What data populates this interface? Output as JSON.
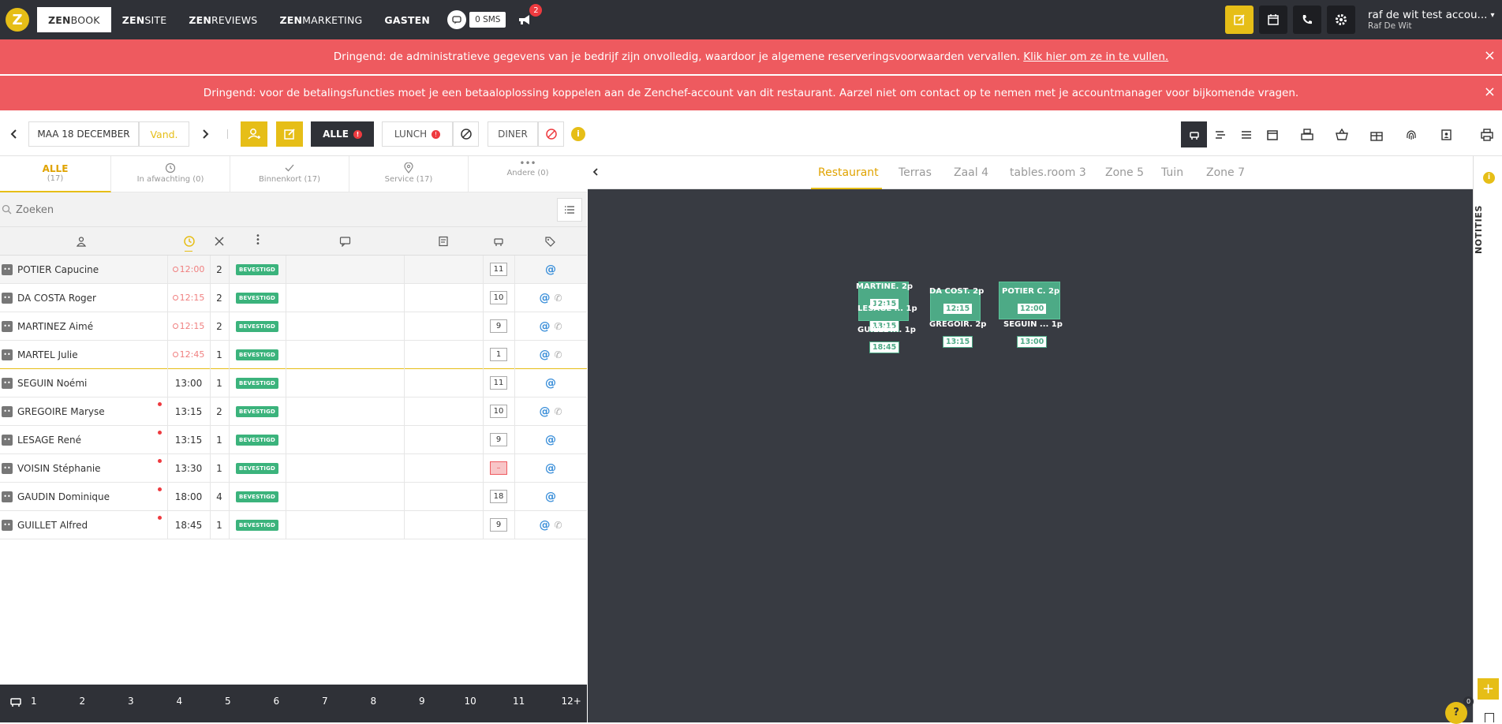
{
  "topnav": {
    "items": [
      {
        "bold": "ZEN",
        "light": "BOOK"
      },
      {
        "bold": "ZEN",
        "light": "SITE"
      },
      {
        "bold": "ZEN",
        "light": "REVIEWS"
      },
      {
        "bold": "ZEN",
        "light": "MARKETING"
      },
      {
        "bold": "GASTEN",
        "light": ""
      }
    ],
    "sms_label": "0 SMS",
    "notif_count": "2",
    "account_name": "raf de wit test accou...",
    "account_user": "Raf De Wit"
  },
  "banners": {
    "admin_text": "Dringend: de administratieve gegevens van je bedrijf zijn onvolledig, waardoor je algemene reserveringsvoorwaarden vervallen.",
    "admin_link": "Klik hier om ze in te vullen.",
    "payment_text": "Dringend: voor de betalingsfuncties moet je een betaaloplossing koppelen aan de Zenchef-account van dit restaurant. Aarzel niet om contact op te nemen met je accountmanager voor bijkomende vragen.",
    "close": "×"
  },
  "toolbar": {
    "date": "MAA 18 DECEMBER",
    "today": "Vand.",
    "all": "ALLE",
    "lunch": "LUNCH",
    "diner": "DINER",
    "info": "i"
  },
  "filters": [
    {
      "label": "ALLE",
      "count": "(17)"
    },
    {
      "label": "In afwachting (0)"
    },
    {
      "label": "Binnenkort (17)"
    },
    {
      "label": "Service (17)"
    },
    {
      "label": "Andere (0)"
    }
  ],
  "search": {
    "placeholder": "Zoeken"
  },
  "reservations": [
    {
      "name": "POTIER Capucine",
      "time": "12:00",
      "late": true,
      "covers": "2",
      "status": "BEVESTIGD",
      "table": "11",
      "phone": false,
      "dot": false
    },
    {
      "name": "DA COSTA Roger",
      "time": "12:15",
      "late": true,
      "covers": "2",
      "status": "BEVESTIGD",
      "table": "10",
      "phone": true,
      "dot": false
    },
    {
      "name": "MARTINEZ Aimé",
      "time": "12:15",
      "late": true,
      "covers": "2",
      "status": "BEVESTIGD",
      "table": "9",
      "phone": true,
      "dot": false
    },
    {
      "name": "MARTEL Julie",
      "time": "12:45",
      "late": true,
      "covers": "1",
      "status": "BEVESTIGD",
      "table": "1",
      "phone": true,
      "dot": false
    },
    {
      "name": "SEGUIN Noémi",
      "time": "13:00",
      "late": false,
      "covers": "1",
      "status": "BEVESTIGD",
      "table": "11",
      "phone": false,
      "dot": false
    },
    {
      "name": "GREGOIRE Maryse",
      "time": "13:15",
      "late": false,
      "covers": "2",
      "status": "BEVESTIGD",
      "table": "10",
      "phone": true,
      "dot": true
    },
    {
      "name": "LESAGE René",
      "time": "13:15",
      "late": false,
      "covers": "1",
      "status": "BEVESTIGD",
      "table": "9",
      "phone": false,
      "dot": true
    },
    {
      "name": "VOISIN Stéphanie",
      "time": "13:30",
      "late": false,
      "covers": "1",
      "status": "BEVESTIGD",
      "table": "–",
      "phone": false,
      "dot": true
    },
    {
      "name": "GAUDIN Dominique",
      "time": "18:00",
      "late": false,
      "covers": "4",
      "status": "BEVESTIGD",
      "table": "18",
      "phone": false,
      "dot": true
    },
    {
      "name": "GUILLET Alfred",
      "time": "18:45",
      "late": false,
      "covers": "1",
      "status": "BEVESTIGD",
      "table": "9",
      "phone": true,
      "dot": true
    }
  ],
  "party_sizes": [
    "1",
    "2",
    "3",
    "4",
    "5",
    "6",
    "7",
    "8",
    "9",
    "10",
    "11",
    "12+"
  ],
  "zones": [
    "Restaurant",
    "Terras",
    "Zaal 4",
    "tables.room 3",
    "Zone 5",
    "Tuin",
    "Zone 7"
  ],
  "floor_tables": [
    {
      "name": "MARTINE. 2p",
      "time": "12:15"
    },
    {
      "name": "LESAGE ... 1p",
      "time": "13:15"
    },
    {
      "name": "GUILLET... 1p",
      "time": "18:45"
    },
    {
      "name": "DA COST. 2p",
      "time": "12:15"
    },
    {
      "name": "GREGOIR. 2p",
      "time": "13:15"
    },
    {
      "name": "POTIER C. 2p",
      "time": "12:00"
    },
    {
      "name": "SEGUIN ... 1p",
      "time": "13:00"
    }
  ],
  "sidebar": {
    "label": "NOTITIES",
    "help_count": "0"
  },
  "colors": {
    "accent": "#e6be17",
    "danger": "#ee5a5f",
    "success": "#3bb37c",
    "dark": "#2f3137"
  }
}
